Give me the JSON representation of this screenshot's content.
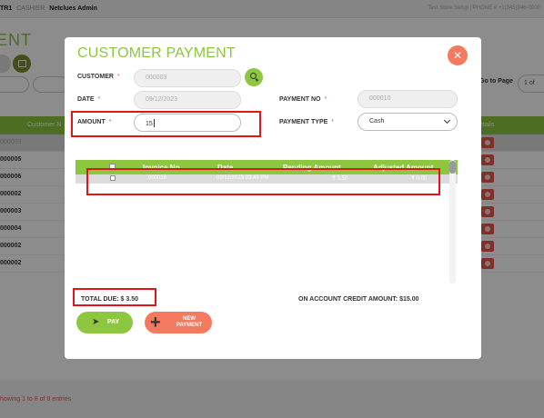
{
  "topbar": {
    "store": "TR1",
    "role": "CASHIER",
    "user": "Netclues Admin",
    "right_text": "Test Store Setup | PHONE # +1(345)946-0000"
  },
  "page": {
    "title_fragment": "ENT",
    "goto_label": "Go to Page",
    "goto_value": "1 of",
    "table_header_customer": "Customer N",
    "table_header_details": "etails",
    "rows": [
      "000003",
      "000005",
      "000006",
      "000002",
      "000003",
      "000004",
      "000002",
      "000002"
    ],
    "footer_text": "howing 1 to 8 of 8 entries"
  },
  "modal": {
    "title": "CUSTOMER PAYMENT",
    "close_symbol": "✕",
    "customer_label": "CUSTOMER",
    "customer_value": "000003",
    "date_label": "DATE",
    "date_value": "09/12/2023",
    "payment_no_label": "PAYMENT NO",
    "payment_no_value": "000010",
    "amount_label": "AMOUNT",
    "amount_value": "15",
    "payment_type_label": "PAYMENT TYPE",
    "payment_type_value": "Cash",
    "required_mark": "*",
    "table": {
      "columns": [
        "Invoice No",
        "Date",
        "Pending Amount",
        "Adjusted Amount"
      ],
      "rows": [
        {
          "invoice": "000016",
          "date": "09/12/2023 03:49 PM",
          "pending": "₹ 3.50",
          "adjusted": "₹ 0.00"
        }
      ]
    },
    "total_due": "TOTAL DUE:  $ 3.50",
    "credit_amount": "ON ACCOUNT CREDIT AMOUNT:  $15.00",
    "pay_label": "PAY",
    "new_payment_label": "NEW PAYMENT"
  },
  "colors": {
    "accent_green": "#8dc63f",
    "accent_orange": "#f4795f",
    "highlight_red": "#e0141b"
  },
  "icons": [
    "calendar-icon",
    "search-icon",
    "close-icon",
    "chevron-down-icon",
    "send-icon",
    "plus-icon",
    "eye-icon"
  ]
}
